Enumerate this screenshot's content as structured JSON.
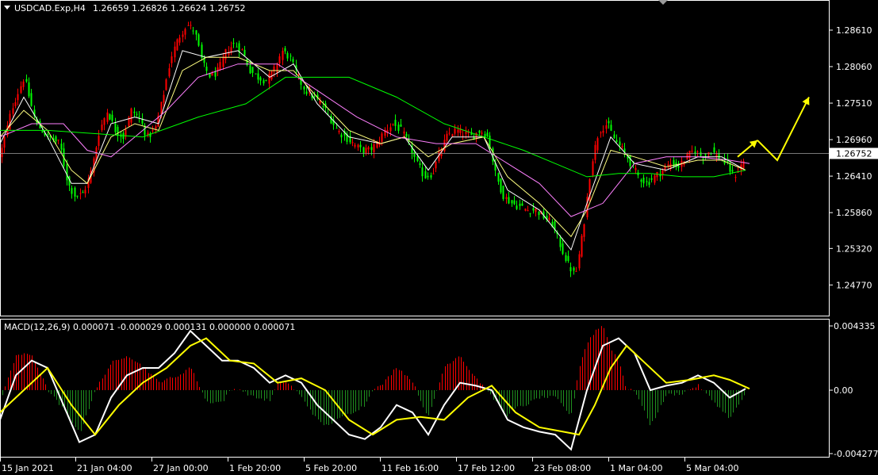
{
  "header": {
    "symbol": "USDCAD.Exp,H4",
    "ohlc": "1.26659 1.26826 1.26624 1.26752"
  },
  "macd_header": {
    "text": "MACD(12,26,9) 0.000071 -0.000029 0.000131 0.000000 0.000071"
  },
  "colors": {
    "background": "#000000",
    "bull": "#ff0000",
    "bear": "#00ff00",
    "ma_fast": "#ffffff",
    "ma_mid": "#ffff80",
    "ma_slow": "#ff80ff",
    "ma_long": "#00ff00",
    "arrows": "#ffff00",
    "macd_line": "#ffffff",
    "signal_line": "#ffff00",
    "hist_pos": "#ff0000",
    "hist_neg": "#1f8f1f",
    "grid": "#ffffff"
  },
  "chart_data": [
    {
      "type": "candlestick",
      "title": "USDCAD.Exp,H4",
      "y_ticks": [
        "1.28610",
        "1.28060",
        "1.27510",
        "1.26960",
        "1.26410",
        "1.25860",
        "1.25320",
        "1.24770"
      ],
      "ylim": [
        1.2432,
        1.2904
      ],
      "current_price": "1.26752",
      "x_ticks": [
        "15 Jan 2021",
        "21 Jan 04:00",
        "27 Jan 00:00",
        "1 Feb 20:00",
        "5 Feb 20:00",
        "11 Feb 16:00",
        "17 Feb 12:00",
        "23 Feb 08:00",
        "1 Mar 04:00",
        "5 Mar 04:00"
      ],
      "close_path": [
        [
          0,
          1.2672
        ],
        [
          15,
          1.2745
        ],
        [
          30,
          1.279
        ],
        [
          45,
          1.272
        ],
        [
          60,
          1.27
        ],
        [
          75,
          1.269
        ],
        [
          85,
          1.263
        ],
        [
          95,
          1.261
        ],
        [
          105,
          1.2615
        ],
        [
          115,
          1.265
        ],
        [
          125,
          1.271
        ],
        [
          135,
          1.274
        ],
        [
          145,
          1.271
        ],
        [
          155,
          1.27
        ],
        [
          165,
          1.274
        ],
        [
          175,
          1.273
        ],
        [
          185,
          1.27
        ],
        [
          195,
          1.271
        ],
        [
          205,
          1.276
        ],
        [
          215,
          1.282
        ],
        [
          225,
          1.285
        ],
        [
          235,
          1.287
        ],
        [
          245,
          1.286
        ],
        [
          255,
          1.281
        ],
        [
          265,
          1.279
        ],
        [
          275,
          1.28
        ],
        [
          285,
          1.283
        ],
        [
          295,
          1.284
        ],
        [
          305,
          1.283
        ],
        [
          315,
          1.28
        ],
        [
          325,
          1.279
        ],
        [
          335,
          1.2785
        ],
        [
          345,
          1.28
        ],
        [
          355,
          1.283
        ],
        [
          365,
          1.282
        ],
        [
          375,
          1.279
        ],
        [
          385,
          1.277
        ],
        [
          395,
          1.276
        ],
        [
          405,
          1.275
        ],
        [
          415,
          1.273
        ],
        [
          425,
          1.271
        ],
        [
          435,
          1.27
        ],
        [
          445,
          1.269
        ],
        [
          455,
          1.268
        ],
        [
          465,
          1.268
        ],
        [
          475,
          1.269
        ],
        [
          485,
          1.271
        ],
        [
          495,
          1.272
        ],
        [
          505,
          1.271
        ],
        [
          515,
          1.269
        ],
        [
          525,
          1.266
        ],
        [
          535,
          1.264
        ],
        [
          545,
          1.2645
        ],
        [
          555,
          1.268
        ],
        [
          565,
          1.2705
        ],
        [
          575,
          1.271
        ],
        [
          585,
          1.2705
        ],
        [
          595,
          1.27
        ],
        [
          605,
          1.271
        ],
        [
          615,
          1.27
        ],
        [
          625,
          1.264
        ],
        [
          635,
          1.261
        ],
        [
          645,
          1.26
        ],
        [
          655,
          1.2595
        ],
        [
          665,
          1.259
        ],
        [
          675,
          1.259
        ],
        [
          685,
          1.258
        ],
        [
          695,
          1.257
        ],
        [
          705,
          1.254
        ],
        [
          715,
          1.251
        ],
        [
          725,
          1.249
        ],
        [
          735,
          1.256
        ],
        [
          745,
          1.266
        ],
        [
          755,
          1.271
        ],
        [
          765,
          1.272
        ],
        [
          775,
          1.2695
        ],
        [
          785,
          1.268
        ],
        [
          795,
          1.266
        ],
        [
          805,
          1.264
        ],
        [
          815,
          1.263
        ],
        [
          825,
          1.264
        ],
        [
          835,
          1.265
        ],
        [
          845,
          1.266
        ],
        [
          855,
          1.2655
        ],
        [
          865,
          1.267
        ],
        [
          875,
          1.268
        ],
        [
          885,
          1.267
        ],
        [
          895,
          1.268
        ],
        [
          905,
          1.267
        ],
        [
          915,
          1.266
        ],
        [
          925,
          1.264
        ],
        [
          935,
          1.266
        ],
        [
          945,
          1.26752
        ]
      ],
      "moving_averages": [
        {
          "color": "#ffffff",
          "points": [
            [
              0,
              1.269
            ],
            [
              30,
              1.276
            ],
            [
              60,
              1.27
            ],
            [
              90,
              1.263
            ],
            [
              110,
              1.263
            ],
            [
              140,
              1.272
            ],
            [
              170,
              1.273
            ],
            [
              200,
              1.272
            ],
            [
              230,
              1.283
            ],
            [
              260,
              1.282
            ],
            [
              300,
              1.283
            ],
            [
              340,
              1.279
            ],
            [
              370,
              1.281
            ],
            [
              400,
              1.275
            ],
            [
              440,
              1.27
            ],
            [
              480,
              1.269
            ],
            [
              510,
              1.27
            ],
            [
              540,
              1.265
            ],
            [
              570,
              1.27
            ],
            [
              610,
              1.27
            ],
            [
              640,
              1.262
            ],
            [
              680,
              1.259
            ],
            [
              720,
              1.253
            ],
            [
              740,
              1.26
            ],
            [
              770,
              1.27
            ],
            [
              800,
              1.266
            ],
            [
              840,
              1.265
            ],
            [
              880,
              1.267
            ],
            [
              910,
              1.267
            ],
            [
              940,
              1.265
            ]
          ]
        },
        {
          "color": "#ffff80",
          "points": [
            [
              0,
              1.27
            ],
            [
              30,
              1.274
            ],
            [
              60,
              1.271
            ],
            [
              90,
              1.265
            ],
            [
              110,
              1.263
            ],
            [
              140,
              1.27
            ],
            [
              170,
              1.272
            ],
            [
              200,
              1.271
            ],
            [
              230,
              1.28
            ],
            [
              260,
              1.282
            ],
            [
              300,
              1.282
            ],
            [
              340,
              1.28
            ],
            [
              370,
              1.28
            ],
            [
              400,
              1.276
            ],
            [
              440,
              1.271
            ],
            [
              480,
              1.269
            ],
            [
              510,
              1.27
            ],
            [
              540,
              1.267
            ],
            [
              570,
              1.269
            ],
            [
              610,
              1.27
            ],
            [
              640,
              1.264
            ],
            [
              680,
              1.26
            ],
            [
              720,
              1.255
            ],
            [
              740,
              1.259
            ],
            [
              770,
              1.268
            ],
            [
              800,
              1.267
            ],
            [
              840,
              1.2655
            ],
            [
              880,
              1.2665
            ],
            [
              910,
              1.2665
            ],
            [
              940,
              1.265
            ]
          ]
        },
        {
          "color": "#ff80ff",
          "points": [
            [
              0,
              1.27
            ],
            [
              40,
              1.272
            ],
            [
              80,
              1.272
            ],
            [
              110,
              1.268
            ],
            [
              140,
              1.267
            ],
            [
              170,
              1.27
            ],
            [
              210,
              1.274
            ],
            [
              250,
              1.279
            ],
            [
              300,
              1.281
            ],
            [
              350,
              1.281
            ],
            [
              400,
              1.277
            ],
            [
              450,
              1.273
            ],
            [
              500,
              1.27
            ],
            [
              550,
              1.269
            ],
            [
              600,
              1.269
            ],
            [
              640,
              1.266
            ],
            [
              680,
              1.263
            ],
            [
              720,
              1.258
            ],
            [
              760,
              1.26
            ],
            [
              800,
              1.266
            ],
            [
              840,
              1.267
            ],
            [
              880,
              1.267
            ],
            [
              920,
              1.2665
            ],
            [
              945,
              1.266
            ]
          ]
        },
        {
          "color": "#00ff00",
          "points": [
            [
              0,
              1.271
            ],
            [
              60,
              1.271
            ],
            [
              120,
              1.2705
            ],
            [
              180,
              1.27
            ],
            [
              250,
              1.273
            ],
            [
              310,
              1.275
            ],
            [
              360,
              1.279
            ],
            [
              400,
              1.279
            ],
            [
              440,
              1.279
            ],
            [
              500,
              1.276
            ],
            [
              560,
              1.272
            ],
            [
              610,
              1.27
            ],
            [
              660,
              1.268
            ],
            [
              700,
              1.266
            ],
            [
              740,
              1.264
            ],
            [
              780,
              1.2645
            ],
            [
              820,
              1.2645
            ],
            [
              860,
              1.264
            ],
            [
              900,
              1.264
            ],
            [
              940,
              1.265
            ]
          ]
        }
      ],
      "forecast_arrows": [
        [
          [
            930,
            1.267
          ],
          [
            955,
            1.2695
          ]
        ],
        [
          [
            955,
            1.2695
          ],
          [
            980,
            1.2665
          ],
          [
            1020,
            1.276
          ]
        ]
      ]
    },
    {
      "type": "macd",
      "title": "MACD(12,26,9)",
      "y_ticks": [
        "0.004335",
        "0.00",
        "-0.004277"
      ],
      "ylim": [
        -0.004277,
        0.004335
      ],
      "macd_line": [
        [
          0,
          -0.002
        ],
        [
          20,
          0.001
        ],
        [
          40,
          0.002
        ],
        [
          60,
          0.0015
        ],
        [
          80,
          -0.001
        ],
        [
          100,
          -0.0035
        ],
        [
          120,
          -0.003
        ],
        [
          140,
          -0.0005
        ],
        [
          160,
          0.001
        ],
        [
          180,
          0.0015
        ],
        [
          200,
          0.0015
        ],
        [
          220,
          0.0025
        ],
        [
          240,
          0.004
        ],
        [
          260,
          0.003
        ],
        [
          280,
          0.002
        ],
        [
          300,
          0.002
        ],
        [
          320,
          0.0015
        ],
        [
          340,
          0.0005
        ],
        [
          360,
          0.001
        ],
        [
          380,
          0.0005
        ],
        [
          400,
          -0.001
        ],
        [
          420,
          -0.002
        ],
        [
          440,
          -0.003
        ],
        [
          460,
          -0.0033
        ],
        [
          480,
          -0.0025
        ],
        [
          500,
          -0.001
        ],
        [
          520,
          -0.0015
        ],
        [
          540,
          -0.003
        ],
        [
          560,
          -0.001
        ],
        [
          580,
          0.0005
        ],
        [
          600,
          0.0003
        ],
        [
          620,
          0.0
        ],
        [
          640,
          -0.002
        ],
        [
          660,
          -0.0025
        ],
        [
          680,
          -0.0028
        ],
        [
          700,
          -0.003
        ],
        [
          720,
          -0.004
        ],
        [
          740,
          0.0
        ],
        [
          760,
          0.003
        ],
        [
          780,
          0.0035
        ],
        [
          800,
          0.0025
        ],
        [
          820,
          0.0
        ],
        [
          840,
          0.0003
        ],
        [
          860,
          0.0005
        ],
        [
          880,
          0.001
        ],
        [
          900,
          0.0005
        ],
        [
          920,
          -0.0005
        ],
        [
          940,
          0.0001
        ]
      ],
      "signal_line": [
        [
          0,
          -0.0015
        ],
        [
          30,
          0.0
        ],
        [
          60,
          0.0015
        ],
        [
          90,
          -0.001
        ],
        [
          120,
          -0.003
        ],
        [
          150,
          -0.001
        ],
        [
          180,
          0.0005
        ],
        [
          210,
          0.0015
        ],
        [
          240,
          0.003
        ],
        [
          260,
          0.0035
        ],
        [
          290,
          0.002
        ],
        [
          320,
          0.0018
        ],
        [
          350,
          0.0005
        ],
        [
          380,
          0.0008
        ],
        [
          410,
          0.0
        ],
        [
          440,
          -0.002
        ],
        [
          470,
          -0.003
        ],
        [
          500,
          -0.002
        ],
        [
          530,
          -0.0018
        ],
        [
          560,
          -0.002
        ],
        [
          590,
          -0.0005
        ],
        [
          620,
          0.0003
        ],
        [
          650,
          -0.0015
        ],
        [
          680,
          -0.0025
        ],
        [
          710,
          -0.0028
        ],
        [
          730,
          -0.003
        ],
        [
          750,
          -0.001
        ],
        [
          770,
          0.0015
        ],
        [
          790,
          0.003
        ],
        [
          810,
          0.002
        ],
        [
          840,
          0.0005
        ],
        [
          870,
          0.0007
        ],
        [
          900,
          0.001
        ],
        [
          920,
          0.0007
        ],
        [
          945,
          0.0001
        ]
      ]
    }
  ]
}
